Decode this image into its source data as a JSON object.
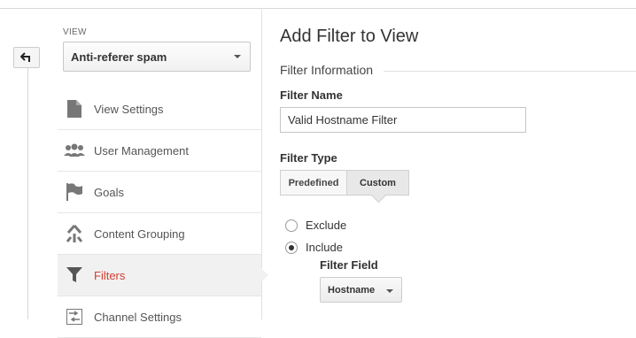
{
  "sidebar": {
    "view_label": "VIEW",
    "view_selected": "Anti-referer spam",
    "items": [
      {
        "label": "View Settings",
        "icon": "document-icon"
      },
      {
        "label": "User Management",
        "icon": "users-icon"
      },
      {
        "label": "Goals",
        "icon": "flag-icon"
      },
      {
        "label": "Content Grouping",
        "icon": "content-grouping-icon"
      },
      {
        "label": "Filters",
        "icon": "filter-icon",
        "active": true
      },
      {
        "label": "Channel Settings",
        "icon": "channel-settings-icon"
      }
    ]
  },
  "main": {
    "title": "Add Filter to View",
    "section_title": "Filter Information",
    "filter_name_label": "Filter Name",
    "filter_name_value": "Valid Hostname Filter",
    "filter_type_label": "Filter Type",
    "filter_type_options": [
      "Predefined",
      "Custom"
    ],
    "filter_type_selected": "Custom",
    "radio_exclude": "Exclude",
    "radio_include": "Include",
    "radio_selected": "Include",
    "filter_field_label": "Filter Field",
    "filter_field_value": "Hostname"
  },
  "colors": {
    "active_text": "#d23f31",
    "icon_gray": "#777777"
  }
}
